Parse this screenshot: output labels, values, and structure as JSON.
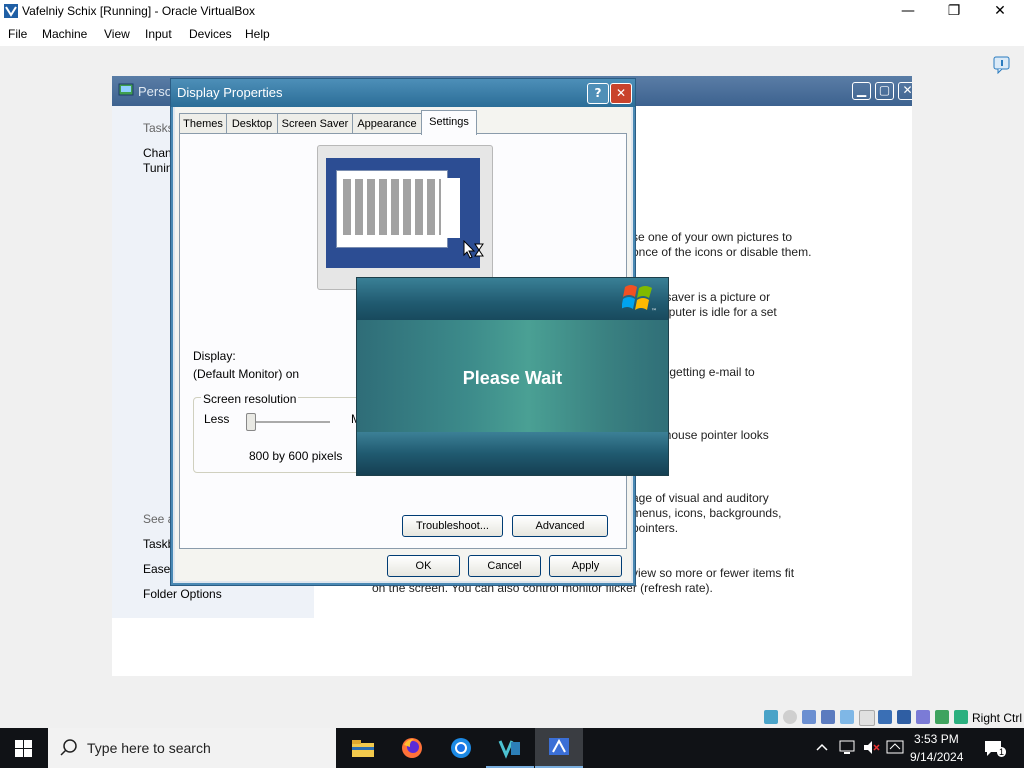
{
  "host": {
    "title": "Vafelniy  Schix [Running] - Oracle VirtualBox",
    "menu": [
      "File",
      "Machine",
      "View",
      "Input",
      "Devices",
      "Help"
    ],
    "minimize_glyph": "—",
    "restore_glyph": "❐",
    "close_glyph": "✕",
    "status_right_label": "Right Ctrl"
  },
  "personalization": {
    "title_fragment": "Perso",
    "left": {
      "tasks_label": "Tasks",
      "task1": "Chan",
      "task2": "Tunin",
      "see_also": "See a",
      "link1": "Taskb",
      "link2": "Ease",
      "link3": "Folder Options"
    },
    "right": {
      "l1": "se one of your own pictures to",
      "l2": "once of the icons or disable them.",
      "l3": "creen saver is a picture or",
      "l4": "ur computer is idle for a set",
      "l5": "g from getting e-mail to",
      "l6": "v the mouse pointer looks",
      "l7": "age of visual and auditory",
      "l8": "menus, icons, backgrounds,",
      "l9": "pointers.",
      "l10": "view so more or fewer items fit",
      "l11": "on the screen. You can also control monitor flicker (refresh rate)."
    }
  },
  "display_properties": {
    "title": "Display Properties",
    "help_glyph": "?",
    "close_glyph": "✕",
    "tabs": [
      "Themes",
      "Desktop",
      "Screen Saver",
      "Appearance",
      "Settings"
    ],
    "selected_tab": "Settings",
    "display_label": "Display:",
    "display_value": "(Default Monitor) on",
    "resolution_group": "Screen resolution",
    "less_label": "Less",
    "more_label": "M",
    "resolution_value": "800 by 600 pixels",
    "troubleshoot_button": "Troubleshoot...",
    "advanced_button": "Advanced",
    "ok_button": "OK",
    "cancel_button": "Cancel",
    "apply_button": "Apply"
  },
  "please_wait": {
    "message": "Please Wait",
    "logo_badge": "™"
  },
  "taskbar": {
    "search_placeholder": "Type here to search",
    "time": "3:53 PM",
    "date": "9/14/2024",
    "notification_count": "1"
  }
}
